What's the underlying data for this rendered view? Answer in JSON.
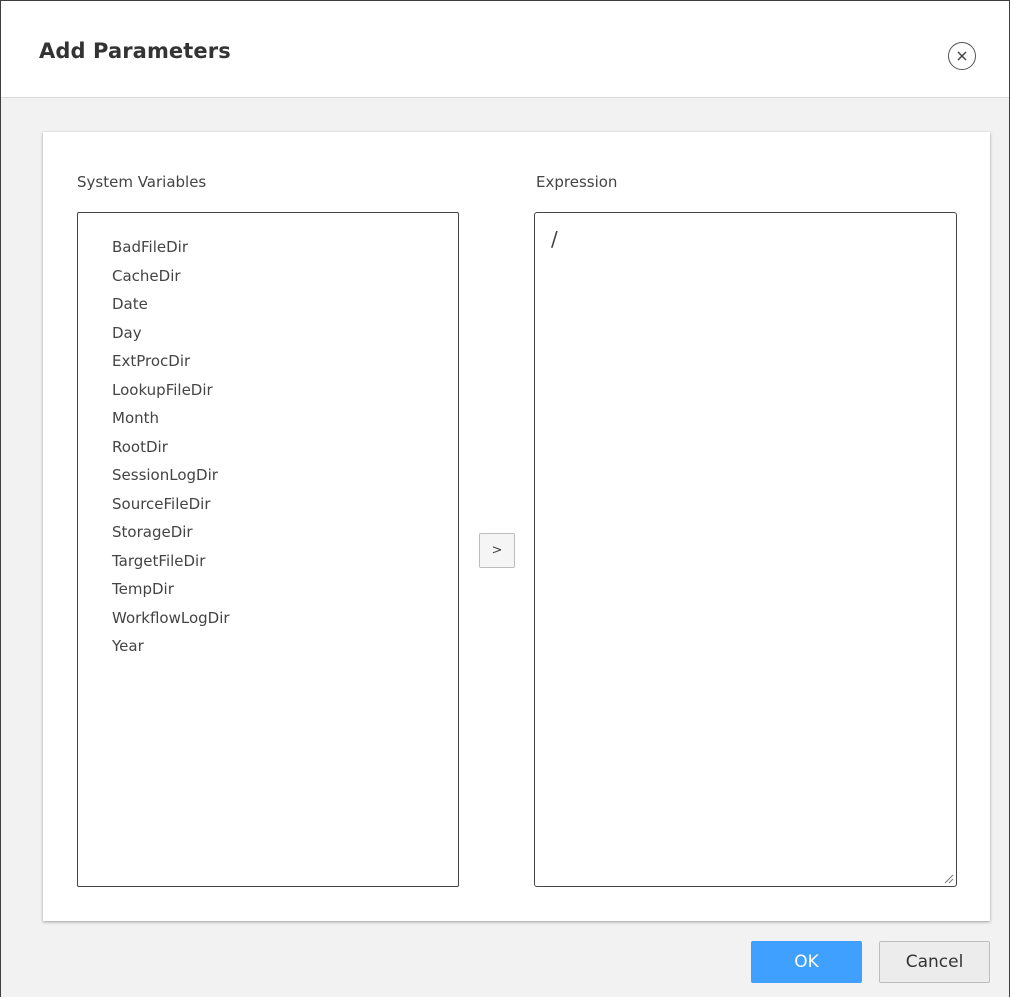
{
  "dialog": {
    "title": "Add Parameters",
    "close_icon": "close-circle-icon"
  },
  "system_variables": {
    "label": "System Variables",
    "items": [
      "BadFileDir",
      "CacheDir",
      "Date",
      "Day",
      "ExtProcDir",
      "LookupFileDir",
      "Month",
      "RootDir",
      "SessionLogDir",
      "SourceFileDir",
      "StorageDir",
      "TargetFileDir",
      "TempDir",
      "WorkflowLogDir",
      "Year"
    ]
  },
  "add_button": {
    "label": ">"
  },
  "expression": {
    "label": "Expression",
    "value": "/"
  },
  "footer": {
    "ok_label": "OK",
    "cancel_label": "Cancel"
  },
  "colors": {
    "accent": "#3fa0ff",
    "panel_bg": "#f2f2f2"
  }
}
